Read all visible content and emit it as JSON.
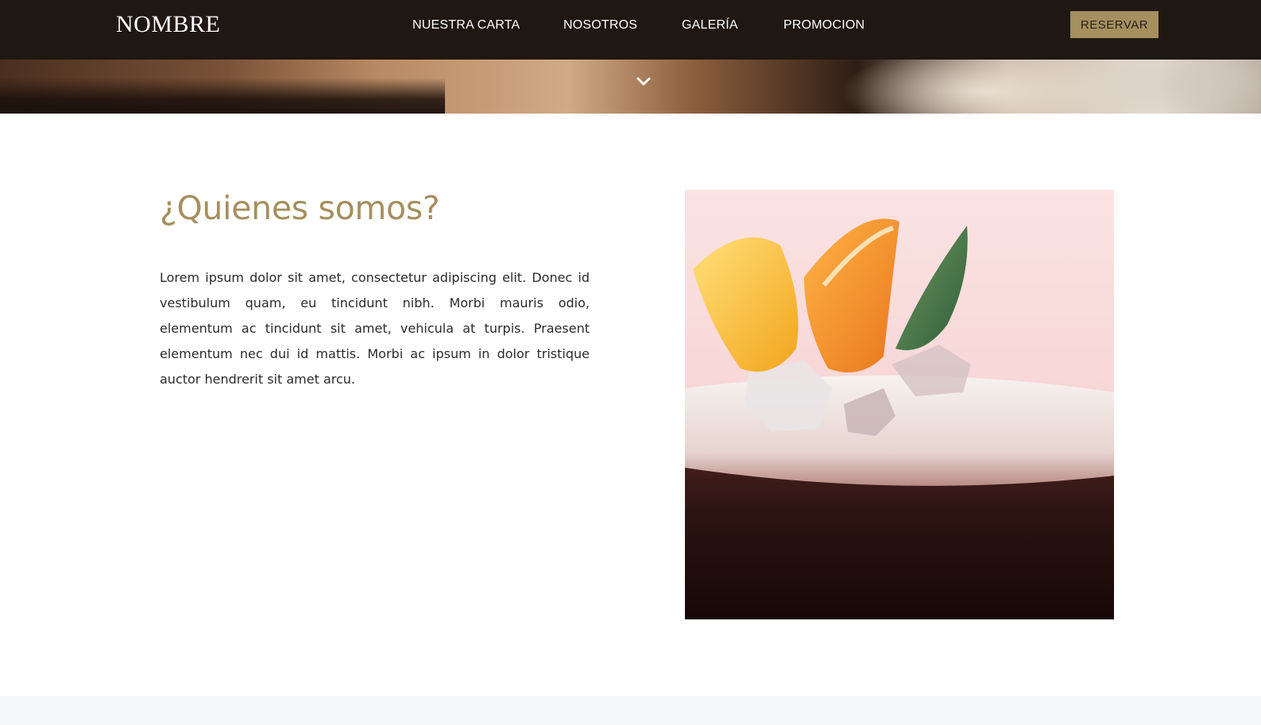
{
  "header": {
    "brand": "NOMBRE",
    "nav": [
      {
        "label": "NUESTRA CARTA"
      },
      {
        "label": "NOSOTROS"
      },
      {
        "label": "GALERÍA"
      },
      {
        "label": "PROMOCION"
      }
    ],
    "reserve_label": "RESERVAR"
  },
  "about": {
    "title": "¿Quienes somos?",
    "text": "Lorem ipsum dolor sit amet, consectetur adipiscing elit. Donec id vestibulum quam, eu tincidunt nibh. Morbi mauris odio, elementum ac tincidunt sit amet, vehicula at turpis. Praesent elementum nec dui id mattis. Morbi ac ipsum in dolor tristique auctor hendrerit sit amet arcu."
  },
  "icons": {
    "scroll": "chevron-down-icon"
  },
  "colors": {
    "nav_bg": "#1f1712",
    "accent": "#a58f5e",
    "text": "#2b2b2b"
  }
}
